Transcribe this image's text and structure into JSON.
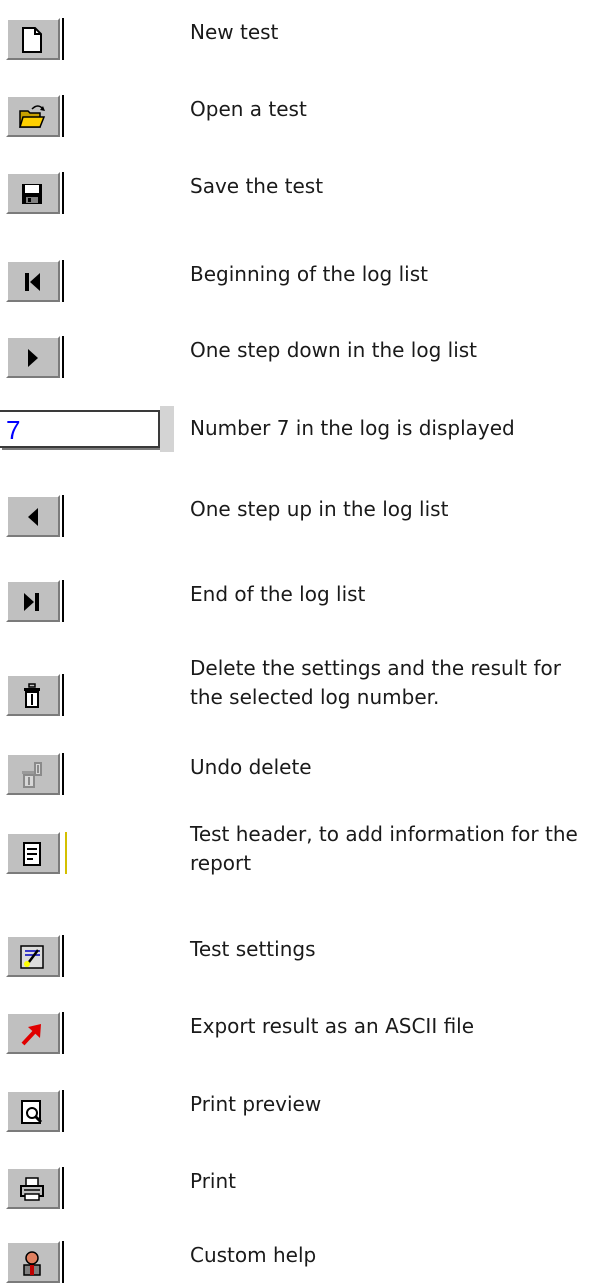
{
  "items": [
    {
      "icon": "new-document-icon",
      "label": "New test"
    },
    {
      "icon": "open-folder-icon",
      "label": "Open a test"
    },
    {
      "icon": "floppy-disk-icon",
      "label": "Save the test"
    },
    {
      "icon": "first-record-icon",
      "label": "Beginning of the log list"
    },
    {
      "icon": "next-record-icon",
      "label": "One step down in the log list"
    },
    {
      "icon": "log-number-field",
      "label": "Number 7 in the log is displayed",
      "value": "7"
    },
    {
      "icon": "previous-record-icon",
      "label": "One step up in the log list"
    },
    {
      "icon": "last-record-icon",
      "label": "End of the log list"
    },
    {
      "icon": "trash-can-icon",
      "label": "Delete the settings and the result for the selected log number."
    },
    {
      "icon": "undo-delete-icon",
      "label": "Undo delete"
    },
    {
      "icon": "test-header-icon",
      "label": "Test header, to add information for the report"
    },
    {
      "icon": "test-settings-icon",
      "label": "Test settings"
    },
    {
      "icon": "export-arrow-icon",
      "label": "Export result as an ASCII file"
    },
    {
      "icon": "print-preview-icon",
      "label": "Print preview"
    },
    {
      "icon": "printer-icon",
      "label": "Print"
    },
    {
      "icon": "custom-help-icon",
      "label": "Custom help"
    }
  ],
  "colors": {
    "button_face": "#c0c0c0",
    "number_text": "#0000ff",
    "export_arrow": "#e00000"
  }
}
